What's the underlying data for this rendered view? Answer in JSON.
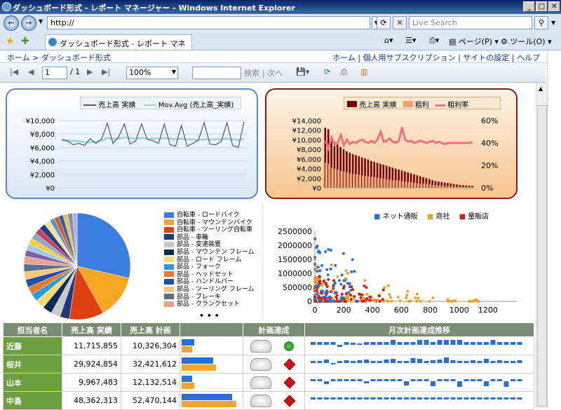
{
  "window": {
    "title": "ダッシュボード形式 - レポート マネージャー - Windows Internet Explorer"
  },
  "address": {
    "url": "http://",
    "search_placeholder": "Live Search"
  },
  "tab": {
    "label": "ダッシュボード形式 - レポート マネージャー"
  },
  "toolbar": {
    "page_label": "ページ(P)",
    "tools_label": "ツール(O)"
  },
  "breadcrumb": {
    "home": "ホーム",
    "sep": ">",
    "current": "ダッシュボード形式",
    "links": [
      "ホーム",
      "個人用サブスクリプション",
      "サイトの設定",
      "ヘルプ"
    ]
  },
  "report_toolbar": {
    "page_value": "1",
    "page_total": "/ 1",
    "zoom": "100%",
    "find_label": "検索",
    "next_label": "次へ"
  },
  "colors": {
    "accent": "#5b86c7",
    "dark_red": "#8b1a1a",
    "green": "#6b9e3c"
  },
  "chart_data": [
    {
      "type": "line",
      "legend": [
        "売上高 実績",
        "Mov.Avg (売上高_実績)"
      ],
      "y_ticks": [
        "¥10,000",
        "¥8,000",
        "¥6,000",
        "¥4,000",
        "¥2,000",
        "¥0"
      ],
      "ylim": [
        0,
        10000
      ],
      "series": [
        {
          "name": "売上高 実績",
          "values": [
            7200,
            7000,
            6400,
            6600,
            6300,
            7300,
            6600,
            7300,
            9600,
            6600,
            7600,
            9500,
            6500,
            7000,
            9500,
            7200,
            7000,
            6600,
            9500,
            6400,
            6200,
            9300,
            6200,
            6600,
            7100,
            9700,
            6500,
            6400,
            6900,
            9700,
            6300,
            6000,
            9800
          ]
        },
        {
          "name": "Mov.Avg (売上高_実績)",
          "values": [
            7000,
            7000,
            7000,
            6900,
            6800,
            6800,
            6800,
            7000,
            7400,
            7300,
            7300,
            7500,
            7400,
            7300,
            7400,
            7300,
            7300,
            7300,
            7400,
            7300,
            7200,
            7300,
            7200,
            7200,
            7100,
            7200,
            7200,
            7200,
            7200,
            7300,
            7200,
            7100,
            7300
          ]
        }
      ]
    },
    {
      "type": "bar",
      "legend": [
        "売上高 実績",
        "粗利",
        "粗利率"
      ],
      "y_ticks": [
        "¥14,000",
        "¥12,000",
        "¥10,000",
        "¥8,000",
        "¥6,000",
        "¥4,000",
        "¥2,000",
        "¥0"
      ],
      "y2_ticks": [
        "60%",
        "40%",
        "20%",
        "0%"
      ],
      "ylim": [
        0,
        14000
      ],
      "series": [
        {
          "name": "売上高 実績",
          "values": [
            12500,
            12200,
            9800,
            9600,
            9000,
            8500,
            8000,
            7600,
            7300,
            7000,
            6800,
            6600,
            6300,
            6100,
            5900,
            5600,
            5400,
            5200,
            5000,
            4800,
            4600,
            4400,
            4200,
            4000,
            3800,
            3600,
            3400,
            3200,
            3000,
            2800,
            2600,
            2400,
            2200,
            2000,
            1800,
            1600,
            1400,
            1300,
            1200,
            1100,
            1000,
            900,
            800,
            700,
            600,
            550,
            500,
            450,
            400
          ]
        },
        {
          "name": "粗利",
          "values": [
            5200,
            5000,
            4200,
            4000,
            3800,
            3500,
            3400,
            3200,
            3000,
            2900,
            2800,
            2700,
            2600,
            2500,
            2400,
            2300,
            2200,
            2100,
            2000,
            1900,
            1800,
            1700,
            1600,
            1600,
            1500,
            1400,
            1300,
            1200,
            1200,
            1100,
            1000,
            900,
            900,
            800,
            700,
            600,
            600,
            500,
            500,
            400,
            400,
            350,
            300,
            250,
            220,
            200,
            180,
            160,
            150
          ]
        },
        {
          "name": "粗利率",
          "values": [
            42,
            35,
            45,
            38,
            40,
            47,
            38,
            43,
            39,
            41,
            40,
            42,
            43,
            41,
            40,
            42,
            40,
            43,
            50,
            41,
            42,
            44,
            41,
            40,
            42,
            54,
            43,
            41,
            42,
            40,
            41,
            42,
            41,
            40,
            41,
            42,
            40,
            41,
            40,
            39,
            40,
            40,
            40,
            40,
            40,
            40,
            40,
            40,
            41
          ]
        }
      ]
    },
    {
      "type": "pie",
      "legend": [
        "自転車 - ロードバイク",
        "自転車 - マウンテンバイク",
        "自転車 - ツーリング自転車",
        "部品 - 車輪",
        "部品 - 変速装置",
        "部品 - マウンテン フレーム",
        "部品 - ロード フレーム",
        "部品 - フォーク",
        "部品 - ヘッドセット",
        "部品 - ハンドルバー",
        "部品 - ツーリング フレーム",
        "部品 - ブレーキ",
        "部品 - クランクセット"
      ],
      "more": "• • •",
      "values": [
        30,
        14,
        11,
        3,
        3,
        3,
        3,
        2.5,
        2.5,
        2.5,
        2.5,
        2.5,
        2.5,
        2,
        2,
        2,
        2,
        2,
        2,
        2,
        1.5,
        1.5,
        1.5,
        1.5,
        1.5,
        1.5
      ],
      "colors": [
        "#3a7fe0",
        "#f6a623",
        "#e04010",
        "#1f3a7a",
        "#c8c8c8",
        "#0b2a56",
        "#f6dc78",
        "#2a9ad8",
        "#ea7a2a",
        "#1f4fa8",
        "#f7c77a",
        "#5c6f8a",
        "#e8a090",
        "#7a5fb0",
        "#a0c8ea",
        "#f0d040",
        "#90a8c8",
        "#c84060",
        "#204080",
        "#f8e0a0",
        "#6090d0",
        "#d06020",
        "#3060a0",
        "#e8c060",
        "#8090b0",
        "#b0b0e0"
      ]
    },
    {
      "type": "scatter",
      "legend": [
        "ネット通販",
        "商社",
        "量販店"
      ],
      "y_ticks": [
        "2500000",
        "2000000",
        "1500000",
        "1000000",
        "500000",
        "0"
      ],
      "x_ticks": [
        "0",
        "200",
        "400",
        "600",
        "800",
        "1000",
        "1200"
      ],
      "xlim": [
        0,
        1400
      ],
      "ylim": [
        0,
        2500000
      ]
    }
  ],
  "table": {
    "headers": [
      "担当者名",
      "売上高 実績",
      "売上高 計画",
      "",
      "計画達成",
      "月次計画達成推移"
    ],
    "rows": [
      {
        "name": "近藤",
        "actual": "11,715,855",
        "plan": "10,326,304",
        "actual_ratio": 0.22,
        "plan_ratio": 0.19,
        "status": "green",
        "spark": [
          4,
          4,
          4,
          4,
          -3,
          4,
          3,
          2,
          4,
          4,
          4,
          4,
          7,
          4,
          4,
          4,
          7,
          7,
          4,
          7,
          7,
          7,
          7,
          4,
          4,
          4,
          4,
          7,
          4,
          4,
          4,
          4
        ]
      },
      {
        "name": "桜井",
        "actual": "29,924,854",
        "plan": "32,421,612",
        "actual_ratio": 0.56,
        "plan_ratio": 0.61,
        "status": "red",
        "spark": [
          3,
          3,
          5,
          -2,
          3,
          4,
          3,
          4,
          5,
          3,
          3,
          5,
          6,
          3,
          3,
          7,
          6,
          3,
          4,
          5,
          8,
          4,
          3,
          3,
          4,
          3,
          6,
          3,
          4,
          3,
          3,
          4
        ]
      },
      {
        "name": "山本",
        "actual": "9,967,483",
        "plan": "12,132,514",
        "actual_ratio": 0.19,
        "plan_ratio": 0.23,
        "status": "red",
        "spark": [
          3,
          3,
          -4,
          3,
          3,
          3,
          3,
          3,
          -3,
          3,
          3,
          3,
          3,
          3,
          -6,
          3,
          3,
          3,
          -7,
          3,
          3,
          3,
          -8,
          3,
          3,
          3,
          -7,
          3,
          3,
          -8,
          3,
          3
        ]
      },
      {
        "name": "中島",
        "actual": "48,362,313",
        "plan": "52,470,144",
        "actual_ratio": 0.9,
        "plan_ratio": 0.98,
        "status": "red",
        "spark": [
          3,
          3,
          3,
          3,
          3,
          3,
          3,
          3,
          3,
          3,
          3,
          3,
          3,
          3,
          3,
          3,
          3,
          3,
          3,
          3,
          3,
          3,
          3,
          3,
          3,
          3,
          3,
          3,
          3,
          3,
          3,
          3
        ]
      }
    ]
  }
}
